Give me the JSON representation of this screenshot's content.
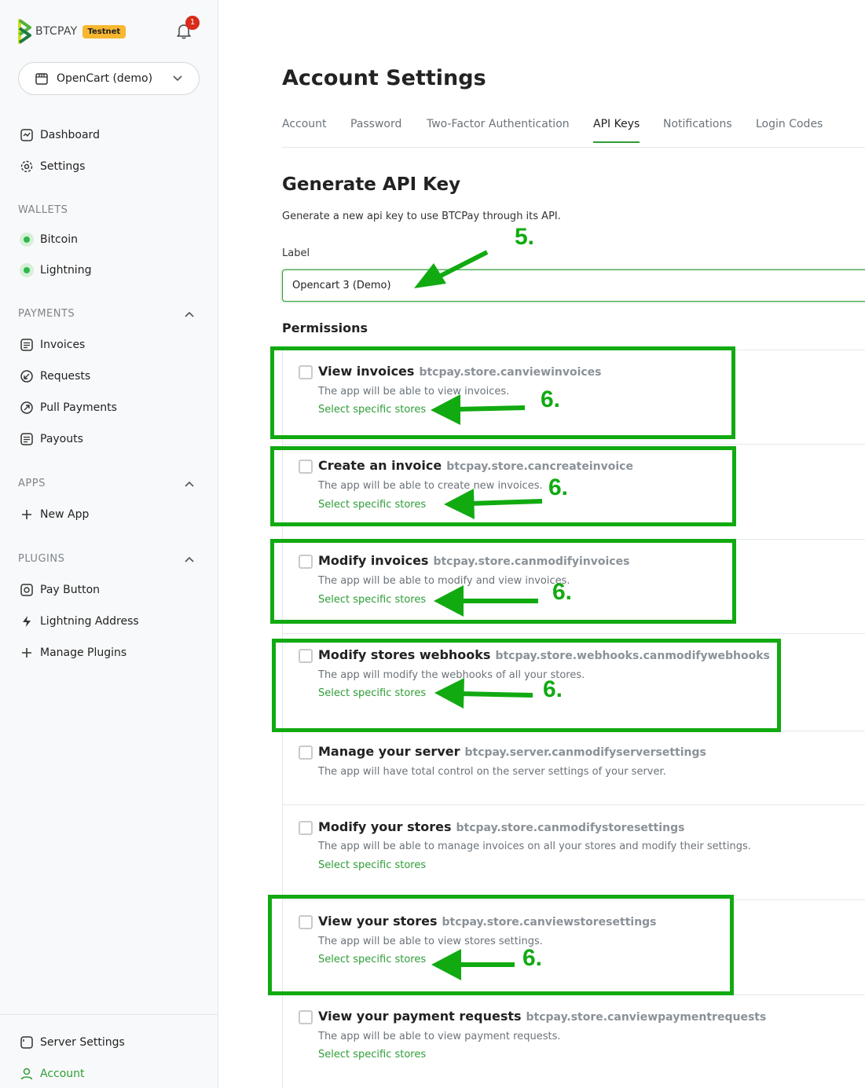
{
  "brand": {
    "name": "BTCPAY",
    "badge": "Testnet",
    "notifications": "1",
    "accent": "#2e9d37"
  },
  "store_select": {
    "name": "OpenCart (demo)"
  },
  "sidebar": {
    "dashboard": "Dashboard",
    "settings": "Settings",
    "wallets_label": "WALLETS",
    "bitcoin": "Bitcoin",
    "lightning": "Lightning",
    "payments_label": "PAYMENTS",
    "invoices": "Invoices",
    "requests": "Requests",
    "pull_payments": "Pull Payments",
    "payouts": "Payouts",
    "apps_label": "APPS",
    "new_app": "New App",
    "plugins_label": "PLUGINS",
    "pay_button": "Pay Button",
    "lightning_address": "Lightning Address",
    "manage_plugins": "Manage Plugins",
    "server_settings": "Server Settings",
    "account": "Account"
  },
  "page": {
    "title": "Account Settings",
    "tabs": [
      "Account",
      "Password",
      "Two-Factor Authentication",
      "API Keys",
      "Notifications",
      "Login Codes"
    ],
    "heading": "Generate API Key",
    "subtitle": "Generate a new api key to use BTCPay through its API.",
    "label_caption": "Label",
    "label_value": "Opencart 3 (Demo)",
    "permissions_heading": "Permissions"
  },
  "permissions": [
    {
      "title": "View invoices",
      "policy": "btcpay.store.canviewinvoices",
      "desc": "The app will be able to view invoices.",
      "link": "Select specific stores"
    },
    {
      "title": "Create an invoice",
      "policy": "btcpay.store.cancreateinvoice",
      "desc": "The app will be able to create new invoices.",
      "link": "Select specific stores"
    },
    {
      "title": "Modify invoices",
      "policy": "btcpay.store.canmodifyinvoices",
      "desc": "The app will be able to modify and view invoices.",
      "link": "Select specific stores"
    },
    {
      "title": "Modify stores webhooks",
      "policy": "btcpay.store.webhooks.canmodifywebhooks",
      "desc": "The app will modify the webhooks of all your stores.",
      "link": "Select specific stores"
    },
    {
      "title": "Manage your server",
      "policy": "btcpay.server.canmodifyserversettings",
      "desc": "The app will have total control on the server settings of your server.",
      "link": ""
    },
    {
      "title": "Modify your stores",
      "policy": "btcpay.store.canmodifystoresettings",
      "desc": "The app will be able to manage invoices on all your stores and modify their settings.",
      "link": "Select specific stores"
    },
    {
      "title": "View your stores",
      "policy": "btcpay.store.canviewstoresettings",
      "desc": "The app will be able to view stores settings.",
      "link": "Select specific stores"
    },
    {
      "title": "View your payment requests",
      "policy": "btcpay.store.canviewpaymentrequests",
      "desc": "The app will be able to view payment requests.",
      "link": "Select specific stores"
    }
  ],
  "annotations": {
    "step5": "5.",
    "step6": "6.",
    "color": "#11aa11"
  }
}
